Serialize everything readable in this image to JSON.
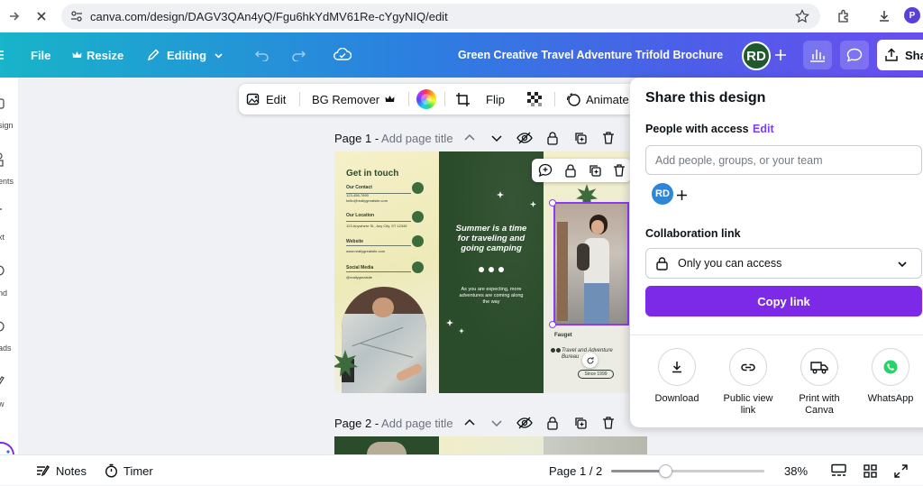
{
  "browser": {
    "url": "canva.com/design/DAGV3QAn4yQ/Fgu6hkYdMV61Re-cYgyNIQ/edit",
    "profile_initial": "P"
  },
  "header": {
    "file_label": "File",
    "resize_label": "Resize",
    "editing_label": "Editing",
    "title": "Green Creative Travel Adventure Trifold Brochure",
    "avatar_initials": "RD",
    "share_label": "Share"
  },
  "left_rail": {
    "items": [
      "sign",
      "ents",
      "xt",
      "nd",
      "ads",
      "w"
    ]
  },
  "image_toolbar": {
    "edit_label": "Edit",
    "bg_remover_label": "BG Remover",
    "flip_label": "Flip",
    "animate_label": "Animate"
  },
  "pages": [
    {
      "label": "Page 1",
      "placeholder": "Add page title"
    },
    {
      "label": "Page 2",
      "placeholder": "Add page title"
    }
  ],
  "brochure": {
    "get_in_touch": "Get in touch",
    "our_contact": "Our Contact",
    "our_location": "Our Location",
    "website": "Website",
    "social_media": "Social Media",
    "contact_lines": [
      "123-456-7890",
      "hello@reallygreatsite.com"
    ],
    "location_line": "123 Anywhere St., Any City, ST 12345",
    "website_line": "www.reallygreatsite.com",
    "social_line": "@reallygreatsite",
    "headline": "Summer is a time for traveling and going camping",
    "body": "As you are expecting, more adventures are coming along the way",
    "fauget": "Fauget",
    "bureau": "Travel and Adventure Bureau",
    "since": "Since 1999"
  },
  "share_panel": {
    "title": "Share this design",
    "people_label": "People with access",
    "edit_link": "Edit",
    "people_placeholder": "Add people, groups, or your team",
    "member_initials": "RD",
    "collab_label": "Collaboration link",
    "access_value": "Only you can access",
    "copy_link_label": "Copy link",
    "options": [
      {
        "label": "Download",
        "icon": "download-icon"
      },
      {
        "label": "Public view link",
        "icon": "link-icon"
      },
      {
        "label": "Print with Canva",
        "icon": "truck-icon"
      },
      {
        "label": "WhatsApp",
        "icon": "whatsapp-icon"
      }
    ]
  },
  "bottom_bar": {
    "notes_label": "Notes",
    "timer_label": "Timer",
    "page_indicator": "Page 1 / 2",
    "zoom_level": "38%",
    "zoom_fraction": 0.35
  },
  "colors": {
    "brand_purple": "#7d2ae8",
    "header_gradient_start": "#18b4c9",
    "header_gradient_end": "#6a4ef0",
    "brochure_green": "#2b4c2b"
  }
}
